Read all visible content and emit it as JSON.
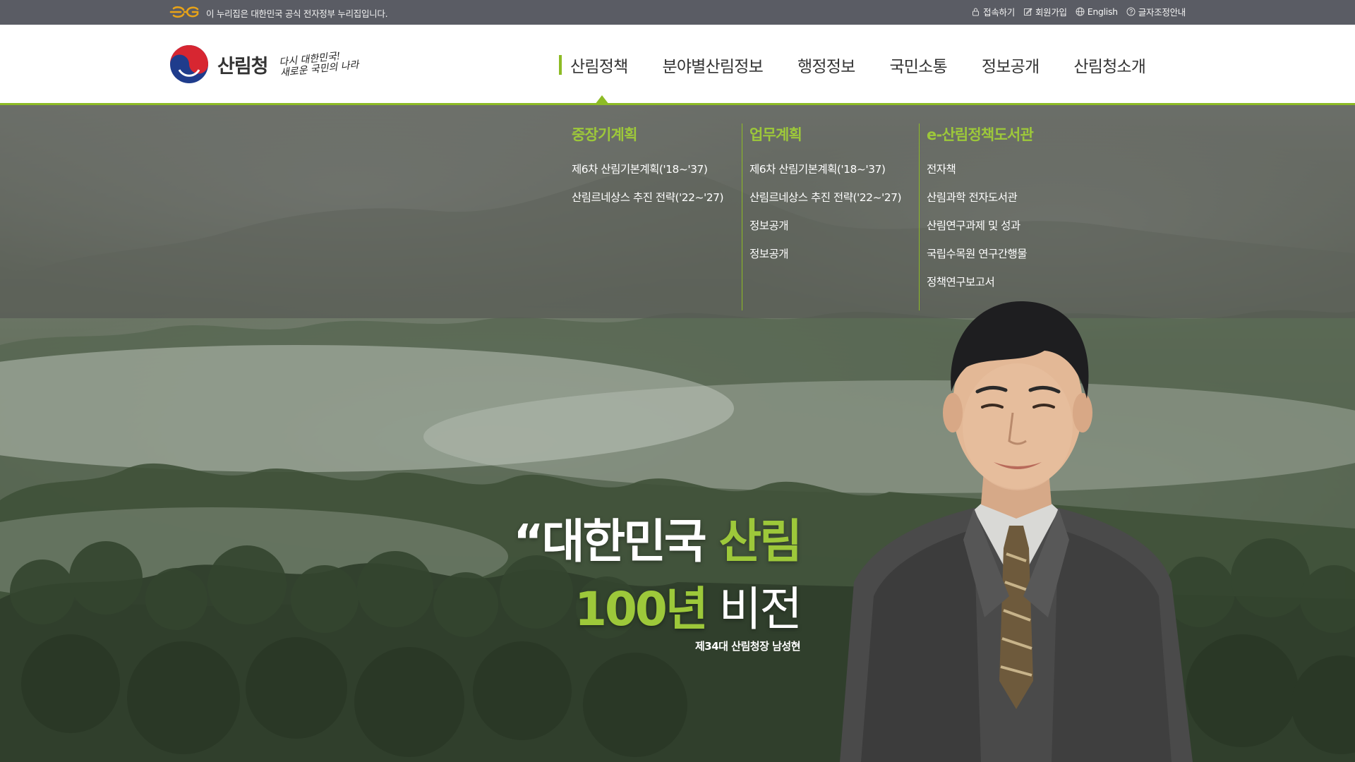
{
  "topbar": {
    "gov_notice": "이 누리집은 대한민국 공식 전자정부 누리집입니다.",
    "utils": [
      {
        "label": "접속하기",
        "icon": "lock-icon"
      },
      {
        "label": "회원가입",
        "icon": "edit-icon"
      },
      {
        "label": "English",
        "icon": "globe-icon"
      },
      {
        "label": "글자조정안내",
        "icon": "help-icon"
      }
    ]
  },
  "header": {
    "logo_text": "산림청",
    "slogan_line1": "다시 대한민국!",
    "slogan_line2": "새로운 국민의 나라",
    "nav": [
      {
        "label": "산림정책",
        "active": true
      },
      {
        "label": "분야별산림정보"
      },
      {
        "label": "행정정보"
      },
      {
        "label": "국민소통"
      },
      {
        "label": "정보공개"
      },
      {
        "label": "산림청소개"
      }
    ]
  },
  "megamenu": {
    "columns": [
      {
        "title": "중장기계획",
        "links": [
          "제6차 산림기본계획('18~'37)",
          "산림르네상스 추진 전략('22~'27)"
        ]
      },
      {
        "title": "업무계획",
        "links": [
          "제6차 산림기본계획('18~'37)",
          "산림르네상스 추진 전략('22~'27)",
          "정보공개",
          "정보공개"
        ]
      },
      {
        "title": "e-산림정책도서관",
        "links": [
          "전자책",
          "산림과학 전자도서관",
          "산림연구과제 및 성과",
          "국립수목원 연구간행물",
          "정책연구보고서"
        ]
      }
    ]
  },
  "hero": {
    "quote_open": "“",
    "line1_white": "대한민국 ",
    "line1_green": "산림",
    "line2_green": "100년",
    "line2_white": " 비전",
    "subtitle": "제34대 산림청장 남성현"
  },
  "colors": {
    "accent": "#8dbb25",
    "accent_text": "#9dc83a",
    "topbar_bg": "#5a5c64",
    "eg_logo": "#e8a317"
  }
}
